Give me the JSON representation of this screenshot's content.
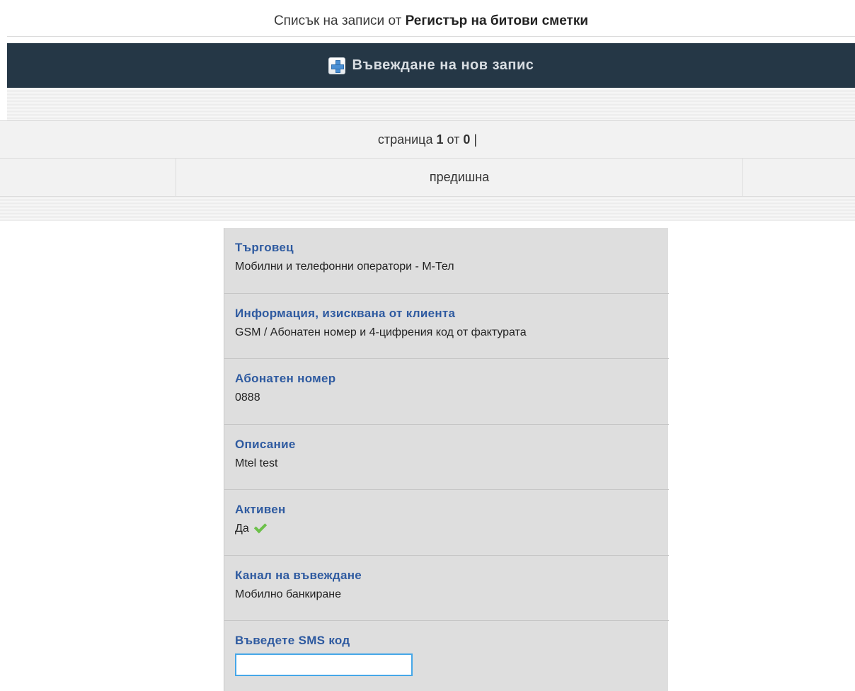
{
  "header": {
    "title_prefix": "Списък на записи от",
    "title_register": "Регистър на битови сметки"
  },
  "toolbar": {
    "add_label": "Въвеждане на нов запис",
    "add_icon": "plus-icon"
  },
  "pagination": {
    "page_word": "страница",
    "current_page": "1",
    "of_word": "от",
    "total_pages": "0",
    "separator": "|",
    "prev_label": "предишна"
  },
  "details": {
    "merchant": {
      "label": "Търговец",
      "value": "Мобилни и телефонни оператори - М-Тел"
    },
    "info_required": {
      "label": "Информация, изисквана от клиента",
      "value": "GSM / Абонатен номер и 4-цифрения код от фактурата"
    },
    "subscriber_number": {
      "label": "Абонатен номер",
      "value": "0888"
    },
    "description": {
      "label": "Описание",
      "value": "Mtel test"
    },
    "active": {
      "label": "Активен",
      "value": "Да",
      "icon": "checkmark-icon"
    },
    "channel": {
      "label": "Канал на въвеждане",
      "value": "Мобилно банкиране"
    },
    "sms_code": {
      "label": "Въведете SMS код",
      "value": ""
    }
  },
  "colors": {
    "toolbar_bg": "#253746",
    "label_blue": "#2e5aa0",
    "panel_bg": "#dedede",
    "input_focus": "#46a7e8",
    "check_green": "#6cc04a"
  }
}
